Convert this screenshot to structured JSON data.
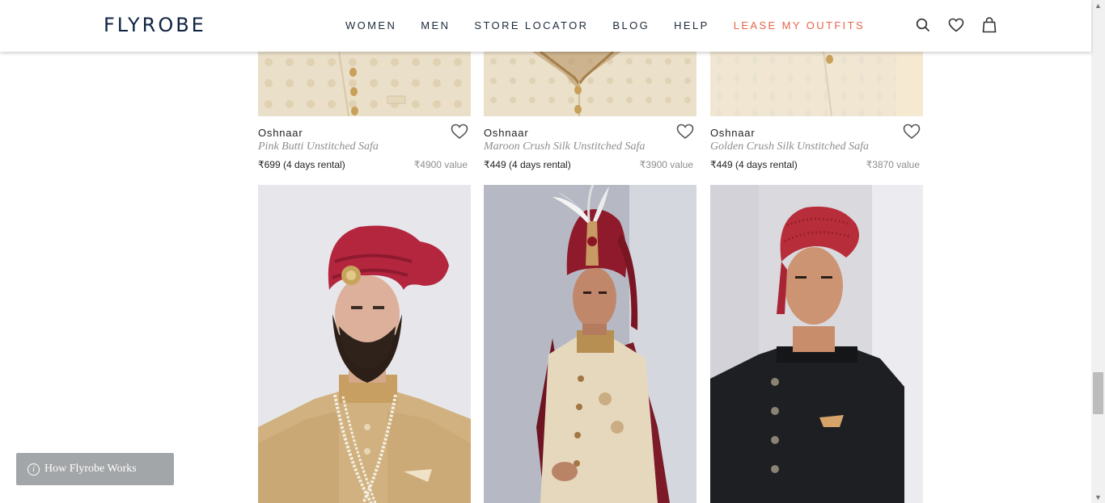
{
  "header": {
    "logo": "FLYROBE",
    "nav": [
      "WOMEN",
      "MEN",
      "STORE LOCATOR",
      "BLOG",
      "HELP",
      "LEASE MY OUTFITS"
    ],
    "icons": [
      "search-icon",
      "heart-icon",
      "bag-icon"
    ],
    "accent_color": "#e9634a"
  },
  "products_row1": [
    {
      "brand": "Oshnaar",
      "name": "Pink Butti Unstitched Safa",
      "price": "₹699 (4 days rental)",
      "value": "₹4900 value"
    },
    {
      "brand": "Oshnaar",
      "name": "Maroon Crush Silk Unstitched Safa",
      "price": "₹449 (4 days rental)",
      "value": "₹3900 value"
    },
    {
      "brand": "Oshnaar",
      "name": "Golden Crush Silk Unstitched Safa",
      "price": "₹449 (4 days rental)",
      "value": "₹3870 value"
    }
  ],
  "products_row2": [
    {
      "image": "man in red turban with gold brooch and golden sherwani with pearl necklace"
    },
    {
      "image": "man in maroon turban with white feather and cream sherwani with maroon stole"
    },
    {
      "image": "man in red turban and black bandhgala jacket"
    }
  ],
  "how_it_works": "How Flyrobe Works"
}
